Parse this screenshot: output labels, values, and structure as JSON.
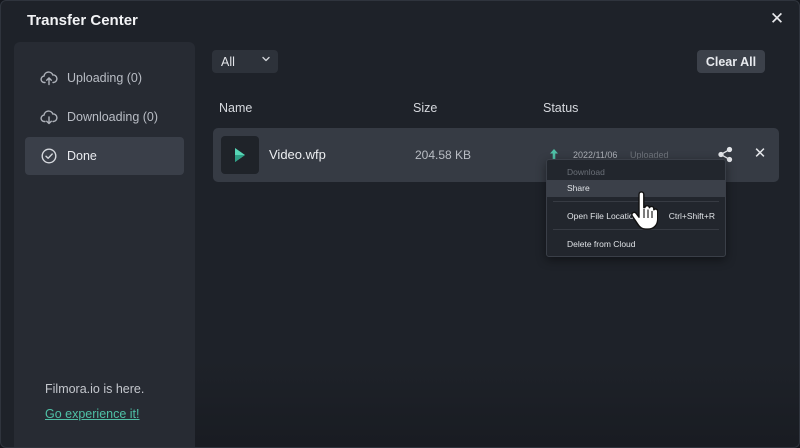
{
  "window": {
    "title": "Transfer Center"
  },
  "sidebar": {
    "items": [
      {
        "label": "Uploading (0)",
        "icon": "cloud-upload-icon"
      },
      {
        "label": "Downloading (0)",
        "icon": "cloud-download-icon"
      },
      {
        "label": "Done",
        "icon": "check-circle-icon"
      }
    ],
    "promo_text": "Filmora.io is here.",
    "promo_link": "Go experience it!"
  },
  "toolbar": {
    "filter_value": "All",
    "clear_all_label": "Clear All"
  },
  "table": {
    "columns": [
      "Name",
      "Size",
      "Status"
    ],
    "rows": [
      {
        "name": "Video.wfp",
        "size": "204.58 KB",
        "date": "2022/11/06",
        "status": "Uploaded"
      }
    ]
  },
  "context_menu": {
    "items": [
      {
        "label": "Download",
        "shortcut": ""
      },
      {
        "label": "Share",
        "shortcut": ""
      },
      {
        "label": "Open File Location",
        "shortcut": "Ctrl+Shift+R"
      },
      {
        "label": "Delete from Cloud",
        "shortcut": ""
      }
    ]
  },
  "colors": {
    "accent": "#4fc0a6",
    "background": "#1e2229",
    "row": "#363b44"
  }
}
